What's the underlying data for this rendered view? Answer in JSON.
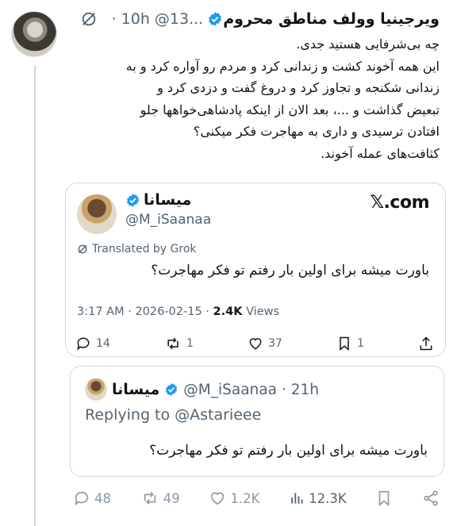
{
  "post": {
    "author_name": "ویرجینیا وولف مناطق محروم",
    "handle": "@13...",
    "time": "· 10h",
    "lines": [
      "چه بی‌شرفایی هستید جدی.",
      "این همه آخوند کشت و زندانی کرد و مردم رو آواره کرد و به",
      "زندانی شکنجه و تجاوز کرد و دروغ گفت و دزدی کرد و",
      "تبعیض گذاشت و ...، بعد الان از اینکه پادشاهی‌خواهها جلو",
      "افتادن ترسیدی و داری به مهاجرت فکر میکنی؟",
      "کثافت‌های عمله آخوند."
    ]
  },
  "quote": {
    "name": "میسانا",
    "handle": "@M_iSaanaa",
    "site": "𝕏.com",
    "translated": "Translated by Grok",
    "text": "باورت میشه برای اولین بار رفتم تو فکر مهاجرت؟",
    "time": "3:17 AM · 2026-02-15 · ",
    "views_count": "2.4K",
    "views_label": " Views",
    "replies": "14",
    "reposts": "1",
    "likes": "37",
    "bookmarks": "1"
  },
  "reply": {
    "name": "میسانا",
    "handle": "@M_iSaanaa",
    "time": "· 21h",
    "replying_to": "Replying to @Astarieee",
    "text": "باورت میشه برای اولین بار رفتم تو فکر مهاجرت؟"
  },
  "actions": {
    "replies": "48",
    "reposts": "49",
    "likes": "1.2K",
    "views": "12.3K"
  },
  "colors": {
    "verified": "#1d9bf0",
    "muted": "#536471",
    "border": "#cfd9de"
  }
}
